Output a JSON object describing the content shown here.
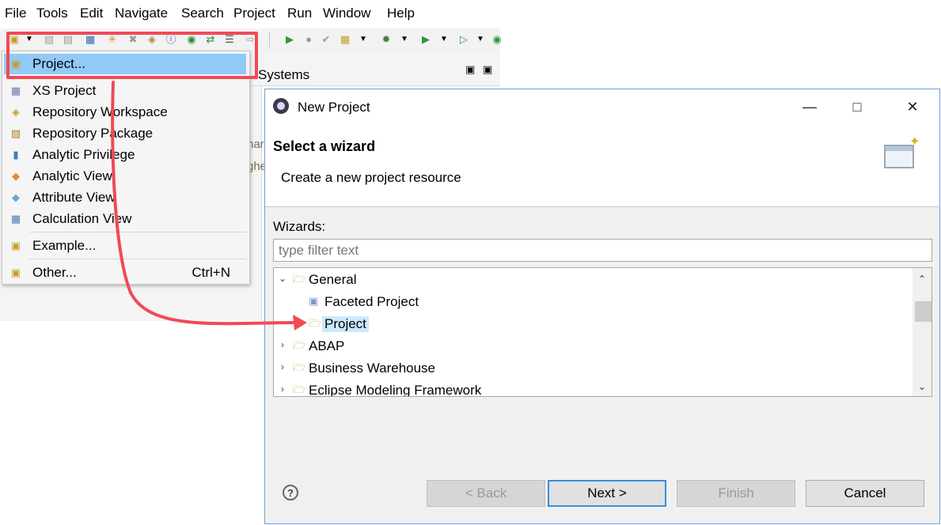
{
  "menubar": {
    "items": [
      "File",
      "Tools",
      "Edit",
      "Navigate",
      "Search",
      "Project",
      "Run",
      "Window",
      "Help"
    ]
  },
  "background": {
    "panel_title": "Systems",
    "fragment1": "har",
    "fragment2": "ghe"
  },
  "dropdown": {
    "items": [
      {
        "label": "Project...",
        "icon": "new-project-icon",
        "accel": "",
        "selected": true
      },
      {
        "label": "XS Project",
        "icon": "xs-project-icon",
        "accel": ""
      },
      {
        "label": "Repository Workspace",
        "icon": "repository-workspace-icon",
        "accel": ""
      },
      {
        "label": "Repository Package",
        "icon": "repository-package-icon",
        "accel": ""
      },
      {
        "label": "Analytic Privilege",
        "icon": "analytic-privilege-icon",
        "accel": ""
      },
      {
        "label": "Analytic View",
        "icon": "analytic-view-icon",
        "accel": ""
      },
      {
        "label": "Attribute View",
        "icon": "attribute-view-icon",
        "accel": ""
      },
      {
        "label": "Calculation View",
        "icon": "calculation-view-icon",
        "accel": ""
      },
      {
        "label": "Example...",
        "icon": "example-icon",
        "accel": ""
      },
      {
        "label": "Other...",
        "icon": "other-icon",
        "accel": "Ctrl+N"
      }
    ]
  },
  "dialog": {
    "title": "New Project",
    "heading": "Select a wizard",
    "description": "Create a new project resource",
    "wizards_label": "Wizards:",
    "filter_placeholder": "type filter text",
    "tree": [
      {
        "label": "General",
        "expanded": true,
        "level": 0
      },
      {
        "label": "Faceted Project",
        "level": 1
      },
      {
        "label": "Project",
        "level": 1,
        "selected": true
      },
      {
        "label": "ABAP",
        "expanded": false,
        "level": 0
      },
      {
        "label": "Business Warehouse",
        "expanded": false,
        "level": 0
      },
      {
        "label": "Eclipse Modeling Framework",
        "expanded": false,
        "level": 0
      }
    ],
    "buttons": {
      "back": "< Back",
      "next": "Next >",
      "finish": "Finish",
      "cancel": "Cancel"
    },
    "help": "?"
  },
  "colors": {
    "highlight": "#f04a55",
    "selection": "#91c9f7",
    "tree_selection": "#cce8ff"
  }
}
